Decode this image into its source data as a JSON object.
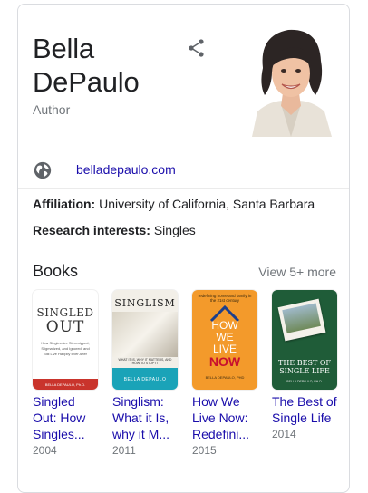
{
  "panel": {
    "name_line1": "Bella",
    "name_line2": "DePaulo",
    "subtitle": "Author",
    "share_icon": "share-icon",
    "website": "belladepaulo.com",
    "website_icon": "globe-icon"
  },
  "facts": [
    {
      "label": "Affiliation:",
      "value": " University of California, Santa Barbara"
    },
    {
      "label": "Research interests:",
      "value": " Singles"
    }
  ],
  "books_section": {
    "title": "Books",
    "view_more": "View 5+ more",
    "items": [
      {
        "title_line1": "Singled",
        "title_line2": "Out: How",
        "title_line3": "Singles...",
        "year": "2004",
        "cover_text_top": "SINGLED",
        "cover_text_mid": "OUT",
        "cover_text_sub": "How Singles Are Stereotyped, Stigmatized, and Ignored, and Still Live Happily Ever After",
        "cover_author": "BELLA DEPAULO, Ph.D."
      },
      {
        "title_line1": "Singlism:",
        "title_line2": "What it Is,",
        "title_line3": "why it M...",
        "year": "2011",
        "cover_text_top": "SINGLISM",
        "cover_text_sub": "WHAT IT IS, WHY IT MATTERS, AND HOW TO STOP IT",
        "cover_author": "BELLA DEPAULO"
      },
      {
        "title_line1": "How We",
        "title_line2": "Live Now:",
        "title_line3": "Redefini...",
        "year": "2015",
        "cover_text_top": "redefining home and family in the 21st century",
        "cover_text_how": "HOW",
        "cover_text_we": "WE",
        "cover_text_live": "LIVE",
        "cover_text_now": "NOW",
        "cover_author": "BELLA DEPAULO, PHD"
      },
      {
        "title_line1": "The Best of",
        "title_line2": "Single Life",
        "year": "2014",
        "cover_text_top": "THE BEST OF",
        "cover_text_mid": "SINGLE LIFE",
        "cover_author": "BELLA DEPAULO, PH.D."
      }
    ]
  },
  "colors": {
    "link": "#1a0dab",
    "muted": "#70757a",
    "border": "#dadce0",
    "orange_cover": "#f39a2b",
    "green_cover": "#1f5c38",
    "teal_band": "#1aa3b8"
  }
}
